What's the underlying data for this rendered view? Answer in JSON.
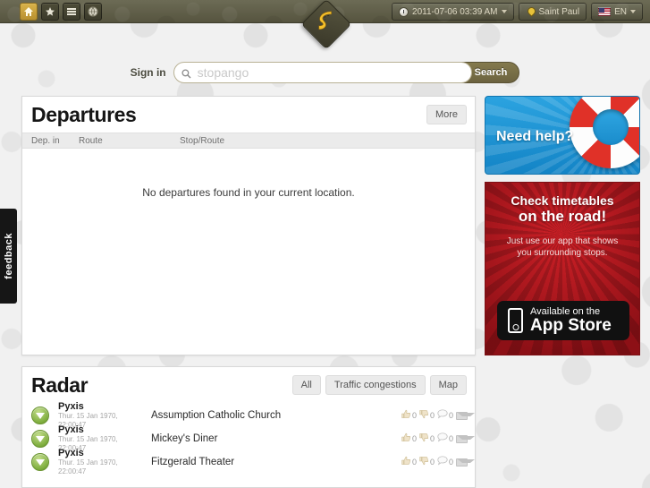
{
  "topbar": {
    "icons": [
      {
        "name": "home-icon",
        "label": "Home",
        "active": true
      },
      {
        "name": "star-icon",
        "label": "Favorites",
        "active": false
      },
      {
        "name": "menu-icon",
        "label": "Menu",
        "active": false
      },
      {
        "name": "globe-icon",
        "label": "Globe",
        "active": false
      }
    ],
    "clock": "2011-07-06 03:39 AM",
    "location": "Saint Paul",
    "language": "EN"
  },
  "logo": {
    "alt": "stopango-logo"
  },
  "search": {
    "signin_label": "Sign in",
    "placeholder": "stopango",
    "value": "",
    "button_label": "Search"
  },
  "departures": {
    "title": "Departures",
    "more_label": "More",
    "columns": [
      "Dep. in",
      "Route",
      "Stop/Route"
    ],
    "empty_message": "No departures found in your current location.",
    "rows": []
  },
  "radar": {
    "title": "Radar",
    "filters": [
      "All",
      "Traffic congestions",
      "Map"
    ],
    "rows": [
      {
        "user": "Pyxis",
        "time": "Thur. 15 Jan 1970, 22:00:47",
        "place": "Assumption Catholic Church",
        "likes": "0",
        "dislikes": "0",
        "comments": "0"
      },
      {
        "user": "Pyxis",
        "time": "Thur. 15 Jan 1970, 22:00:47",
        "place": "Mickey's Diner",
        "likes": "0",
        "dislikes": "0",
        "comments": "0"
      },
      {
        "user": "Pyxis",
        "time": "Thur. 15 Jan 1970, 22:00:47",
        "place": "Fitzgerald Theater",
        "likes": "0",
        "dislikes": "0",
        "comments": "0"
      }
    ]
  },
  "ads": {
    "help": {
      "text": "Need help?"
    },
    "app": {
      "line1": "Check timetables",
      "line2": "on the road!",
      "sub": "Just use our app that shows you surrounding stops.",
      "store_small": "Available on the",
      "store_big": "App Store"
    }
  },
  "feedback": {
    "label": "feedback"
  },
  "colors": {
    "topbar": "#5c5a44",
    "accent_gold": "#847a4d",
    "ad_blue": "#1f95d6",
    "ad_red": "#b81d23",
    "badge_green": "#7fae3e"
  }
}
